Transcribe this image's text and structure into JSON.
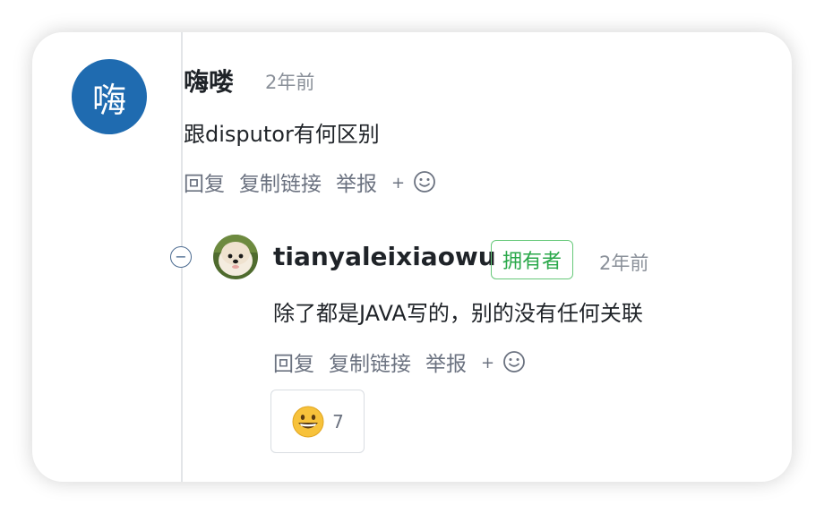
{
  "comment": {
    "avatar_text": "嗨",
    "author": "嗨喽",
    "time": "2年前",
    "content": "跟disputor有何区别",
    "actions": {
      "reply": "回复",
      "copy_link": "复制链接",
      "report": "举报",
      "add_reaction": "+"
    }
  },
  "reply": {
    "collapse_symbol": "−",
    "author": "tianyaleixiaowu",
    "badge": "拥有者",
    "time": "2年前",
    "content": "除了都是JAVA写的，别的没有任何关联",
    "actions": {
      "reply": "回复",
      "copy_link": "复制链接",
      "report": "举报",
      "add_reaction": "+"
    },
    "reaction": {
      "emoji_name": "grinning-face",
      "count": "7"
    }
  },
  "colors": {
    "avatar_bg": "#1f6bb0",
    "owner_badge": "#2aa84a",
    "thread_line": "#e3e5e8"
  }
}
